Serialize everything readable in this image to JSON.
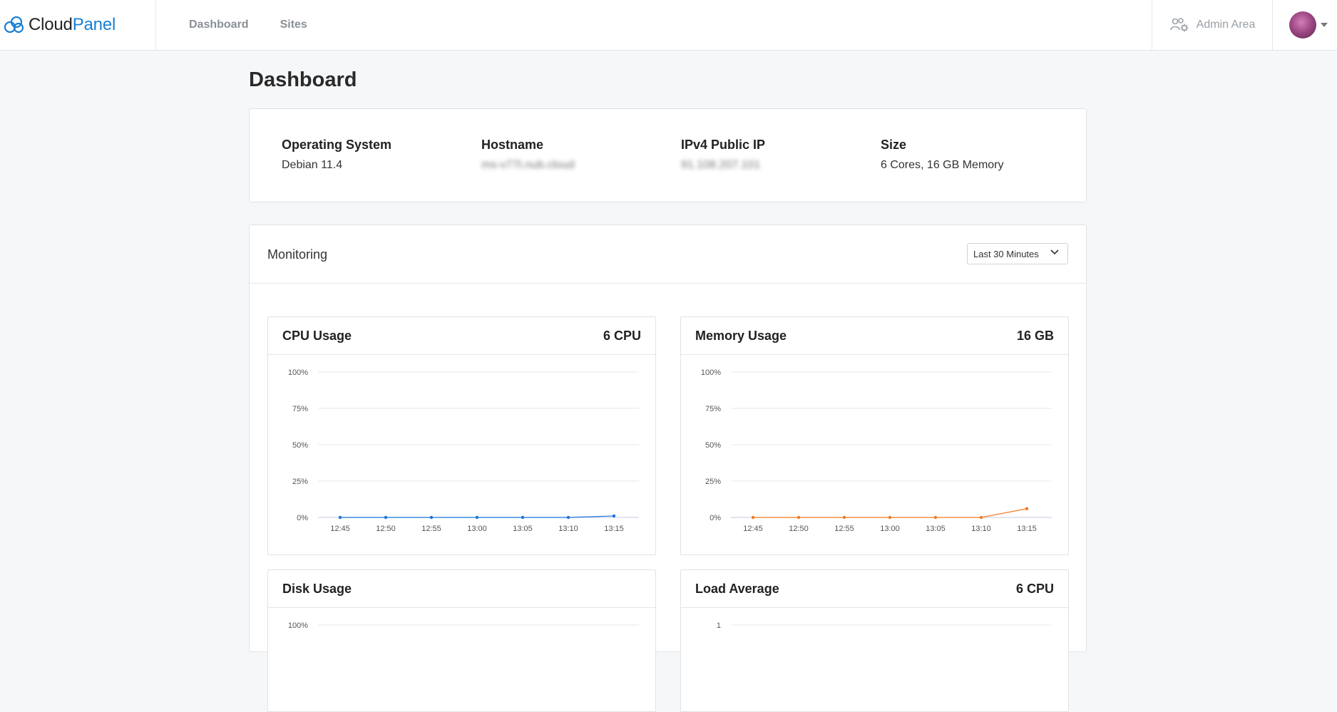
{
  "brand": {
    "part1": "Cloud",
    "part2": "Panel",
    "accent": "#1a7fd4"
  },
  "nav": {
    "items": [
      {
        "label": "Dashboard"
      },
      {
        "label": "Sites"
      }
    ]
  },
  "header": {
    "admin_label": "Admin Area",
    "admin_icon": "users-gear-icon",
    "avatar_icon": "user-avatar"
  },
  "page": {
    "title": "Dashboard"
  },
  "server_info": {
    "os_label": "Operating System",
    "os_value": "Debian 11.4",
    "hostname_label": "Hostname",
    "hostname_value": "ms-v77t.nub.cloud",
    "ip_label": "IPv4 Public IP",
    "ip_value": "91.108.207.101",
    "size_label": "Size",
    "size_value": "6 Cores, 16 GB Memory"
  },
  "monitoring": {
    "title": "Monitoring",
    "range": {
      "selected": "Last 30 Minutes"
    },
    "cards": {
      "cpu": {
        "title": "CPU Usage",
        "badge": "6 CPU"
      },
      "memory": {
        "title": "Memory Usage",
        "badge": "16 GB"
      },
      "disk": {
        "title": "Disk Usage",
        "badge": ""
      },
      "load": {
        "title": "Load Average",
        "badge": "6 CPU"
      }
    }
  },
  "chart_data": [
    {
      "type": "line",
      "title": "CPU Usage",
      "x": [
        "12:45",
        "12:50",
        "12:55",
        "13:00",
        "13:05",
        "13:10",
        "13:15"
      ],
      "y_ticks": [
        "100%",
        "75%",
        "50%",
        "25%",
        "0%"
      ],
      "ylim": [
        0,
        100
      ],
      "series": [
        {
          "values": [
            0,
            0,
            0,
            0,
            0,
            0,
            1
          ],
          "color": "#1a73d9"
        }
      ],
      "grid": true
    },
    {
      "type": "line",
      "title": "Memory Usage",
      "x": [
        "12:45",
        "12:50",
        "12:55",
        "13:00",
        "13:05",
        "13:10",
        "13:15"
      ],
      "y_ticks": [
        "100%",
        "75%",
        "50%",
        "25%",
        "0%"
      ],
      "ylim": [
        0,
        100
      ],
      "series": [
        {
          "values": [
            0,
            0,
            0,
            0,
            0,
            0,
            6
          ],
          "color": "#f07a22"
        }
      ],
      "grid": true
    },
    {
      "type": "line",
      "title": "Disk Usage",
      "x": [],
      "y_ticks": [
        "100%"
      ],
      "ylim": [
        0,
        100
      ],
      "series": [],
      "grid": true
    },
    {
      "type": "line",
      "title": "Load Average",
      "x": [],
      "y_ticks": [
        "1"
      ],
      "ylim": [
        0,
        1
      ],
      "series": [],
      "grid": true
    }
  ]
}
